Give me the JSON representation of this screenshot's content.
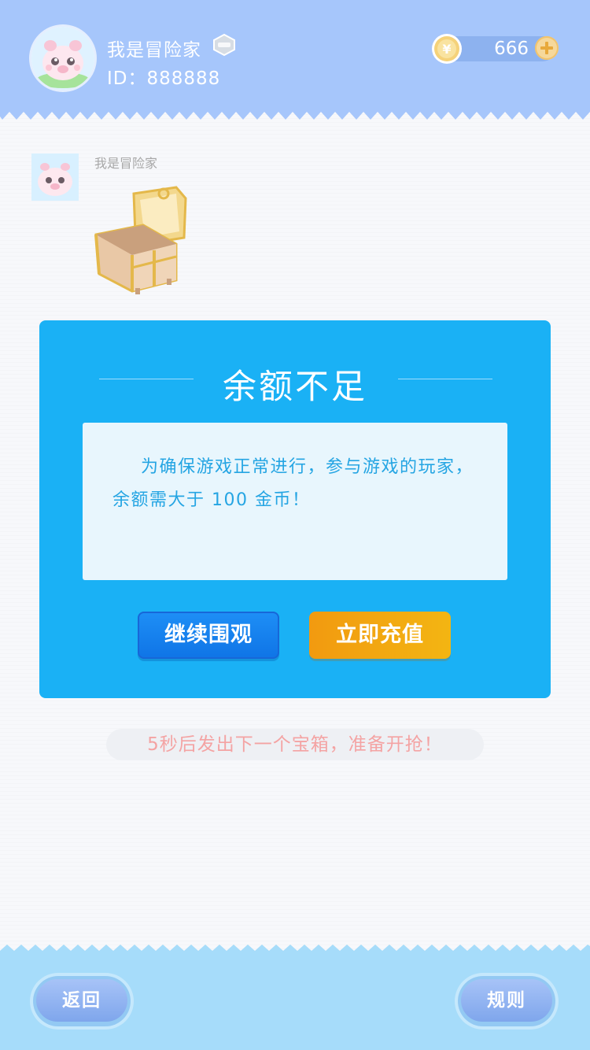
{
  "header": {
    "username": "我是冒险家",
    "user_id": "ID：888888",
    "coins": "666"
  },
  "message": {
    "sender_name": "我是冒险家"
  },
  "dialog": {
    "title": "余额不足",
    "body": "为确保游戏正常进行，参与游戏的玩家，余额需大于 100 金币！",
    "watch_button": "继续围观",
    "recharge_button": "立即充值"
  },
  "notice": "5秒后发出下一个宝箱，准备开抢！",
  "footer": {
    "back_button": "返回",
    "rules_button": "规则"
  },
  "colors": {
    "header": "#a6c6fb",
    "dialog": "#1ab1f5",
    "recharge": "#f3a712",
    "watch": "#1283ee",
    "footer": "#a6dcfa"
  }
}
